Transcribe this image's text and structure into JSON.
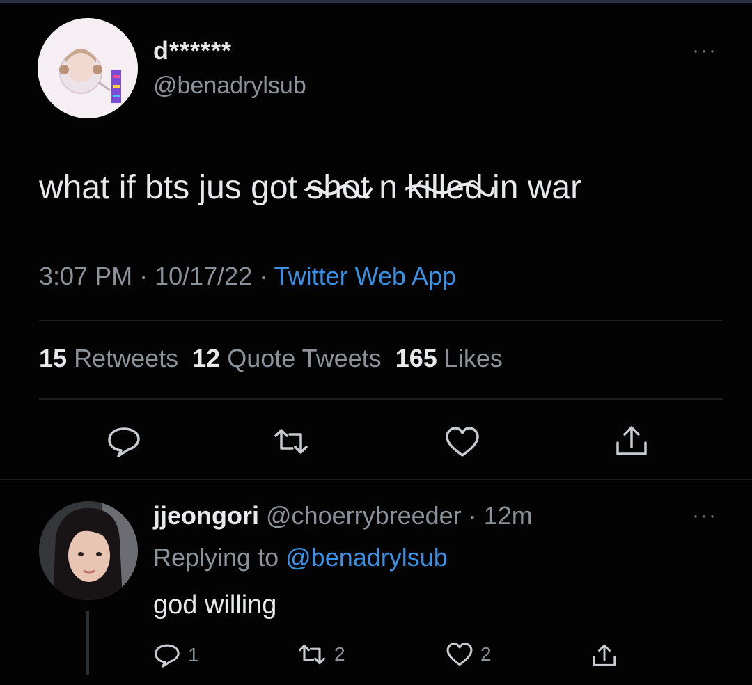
{
  "tweet": {
    "display_name": "d******",
    "handle": "@benadrylsub",
    "text_before": "what if bts jus got ",
    "scribble_1": "shot",
    "text_middle": " n ",
    "scribble_2": "killed",
    "text_after": " in war",
    "time": "3:07 PM",
    "date": "10/17/22",
    "source": "Twitter Web App",
    "retweets_count": "15",
    "retweets_label": "Retweets",
    "quotes_count": "12",
    "quotes_label": "Quote Tweets",
    "likes_count": "165",
    "likes_label": "Likes",
    "more_label": "···"
  },
  "reply": {
    "display_name": "jjeongori",
    "handle": "@choerrybreeder",
    "age": "12m",
    "replying_prefix": "Replying to",
    "replying_to": "@benadrylsub",
    "text": "god willing",
    "reply_count": "1",
    "retweet_count": "2",
    "like_count": "2",
    "more_label": "···"
  },
  "colors": {
    "background": "#030303",
    "text": "#e7e9ea",
    "secondary": "#8b9299",
    "link": "#3a92e6"
  },
  "icons": [
    "reply-icon",
    "retweet-icon",
    "like-icon",
    "share-icon",
    "more-icon"
  ]
}
